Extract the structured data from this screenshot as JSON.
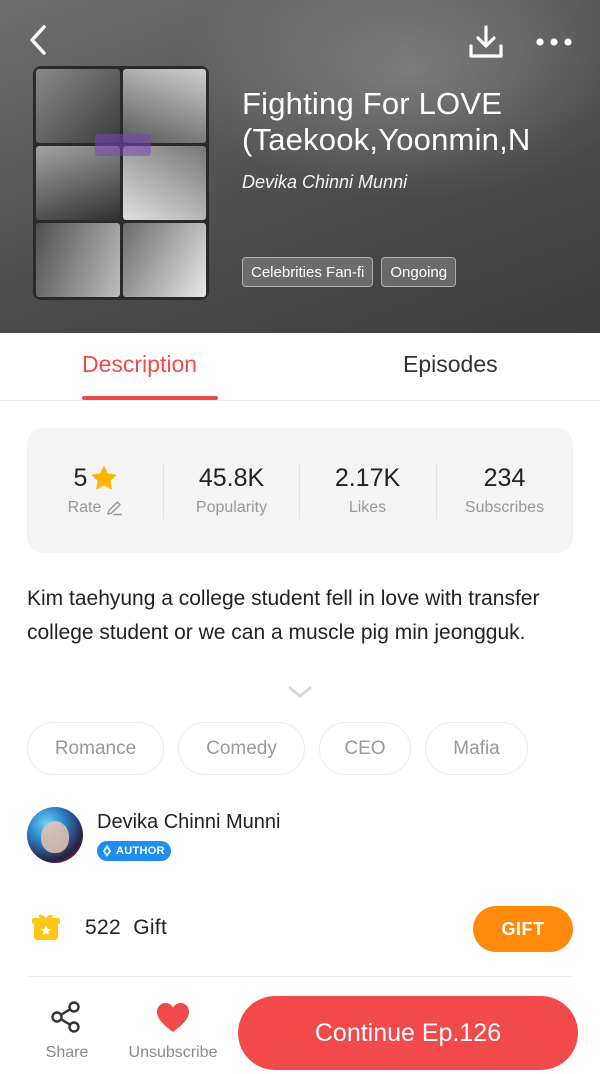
{
  "header": {
    "back_icon": "chevron-left-icon",
    "download_icon": "download-icon",
    "more_icon": "more-horizontal-icon"
  },
  "book": {
    "title": "Fighting For LOVE\n(Taekook,Yoonmin,N",
    "author": "Devika Chinni Munni",
    "tags": [
      "Celebrities Fan-fi",
      "Ongoing"
    ]
  },
  "tabs": {
    "description": "Description",
    "episodes": "Episodes",
    "active": "description"
  },
  "stats": {
    "rate_value": "5",
    "rate_label": "Rate",
    "popularity_value": "45.8K",
    "popularity_label": "Popularity",
    "likes_value": "2.17K",
    "likes_label": "Likes",
    "subscribes_value": "234",
    "subscribes_label": "Subscribes"
  },
  "description": {
    "text": "Kim taehyung a college student fell in love with transfer college student or we can a muscle pig min jeongguk."
  },
  "categories": [
    "Romance",
    "Comedy",
    "CEO",
    "Mafia"
  ],
  "author_card": {
    "name": "Devika Chinni Munni",
    "badge": "AUTHOR"
  },
  "gift": {
    "count_text": "522  Gift",
    "button": "GIFT"
  },
  "bottom_bar": {
    "share": "Share",
    "unsubscribe": "Unsubscribe",
    "continue": "Continue Ep.126"
  },
  "colors": {
    "accent": "#ee4b4b",
    "continue_button": "#f24a4a",
    "gift_button": "#ff8a0c",
    "star": "#ffb400",
    "author_badge": "#1e8ff1"
  }
}
